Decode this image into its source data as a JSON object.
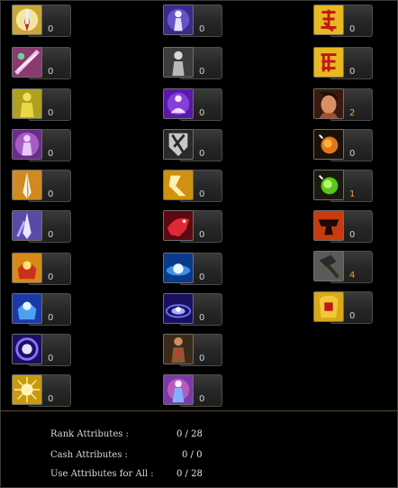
{
  "columns": [
    {
      "slots": [
        {
          "icon": "sword-crest-icon",
          "value": "0"
        },
        {
          "icon": "sword-slash-icon",
          "value": "0"
        },
        {
          "icon": "golden-body-icon",
          "value": "0"
        },
        {
          "icon": "aura-body-icon",
          "value": "0"
        },
        {
          "icon": "blade-strike-icon",
          "value": "0"
        },
        {
          "icon": "ice-sword-icon",
          "value": "0"
        },
        {
          "icon": "flame-hand-icon",
          "value": "0"
        },
        {
          "icon": "frost-hand-icon",
          "value": "0"
        },
        {
          "icon": "energy-orb-icon",
          "value": "0"
        },
        {
          "icon": "light-burst-icon",
          "value": "0"
        }
      ]
    },
    {
      "slots": [
        {
          "icon": "spirit-figure-icon",
          "value": "0"
        },
        {
          "icon": "silver-figure-icon",
          "value": "0"
        },
        {
          "icon": "meditation-icon",
          "value": "0"
        },
        {
          "icon": "shield-break-icon",
          "value": "0"
        },
        {
          "icon": "dash-kick-icon",
          "value": "0"
        },
        {
          "icon": "red-beast-icon",
          "value": "0"
        },
        {
          "icon": "blue-light-icon",
          "value": "0"
        },
        {
          "icon": "vortex-icon",
          "value": "0"
        },
        {
          "icon": "warrior-figure-icon",
          "value": "0"
        },
        {
          "icon": "arcane-figure-icon",
          "value": "0"
        }
      ]
    },
    {
      "slots": [
        {
          "icon": "red-glyph-icon",
          "value": "0"
        },
        {
          "icon": "red-glyph-2-icon",
          "value": "0"
        },
        {
          "icon": "hero-portrait-icon",
          "value": "2"
        },
        {
          "icon": "fire-orb-icon",
          "value": "0"
        },
        {
          "icon": "green-orb-icon",
          "value": "1"
        },
        {
          "icon": "red-anvil-icon",
          "value": "0"
        },
        {
          "icon": "hammer-icon",
          "value": "4"
        },
        {
          "icon": "golden-armor-icon",
          "value": "0"
        }
      ]
    }
  ],
  "attributes": [
    {
      "label": "Rank Attributes :",
      "value": "0 / 28"
    },
    {
      "label": "Cash Attributes :",
      "value": "0 / 0"
    },
    {
      "label": "Use Attributes for All :",
      "value": "0 / 28"
    }
  ],
  "colors": {
    "highlight": "#e59a43",
    "separator": "#5a4a32"
  }
}
